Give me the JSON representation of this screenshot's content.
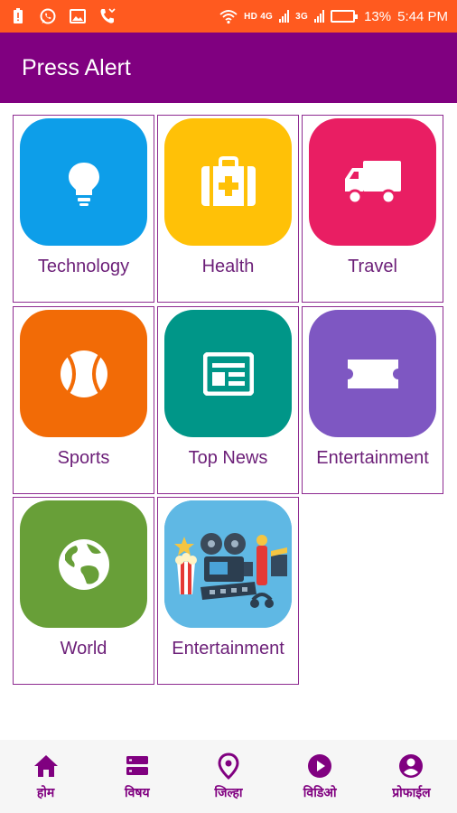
{
  "status_bar": {
    "network_hd": "HD 4G",
    "network_3g": "3G",
    "battery": "13%",
    "time": "5:44 PM"
  },
  "app_bar": {
    "title": "Press Alert"
  },
  "categories": [
    {
      "label": "Technology",
      "color": "#0d9ee9",
      "icon": "lightbulb-icon"
    },
    {
      "label": "Health",
      "color": "#ffc107",
      "icon": "first-aid-kit-icon"
    },
    {
      "label": "Travel",
      "color": "#e91e63",
      "icon": "truck-icon"
    },
    {
      "label": "Sports",
      "color": "#f26b06",
      "icon": "ball-icon"
    },
    {
      "label": "Top News",
      "color": "#009688",
      "icon": "newspaper-icon"
    },
    {
      "label": "Entertainment",
      "color": "#7e57c2",
      "icon": "ticket-icon"
    },
    {
      "label": "World",
      "color": "#689f38",
      "icon": "globe-icon"
    },
    {
      "label": "Entertainment",
      "color": "#5fb8e4",
      "icon": "cinema-collage-icon"
    }
  ],
  "bottom_nav": [
    {
      "label": "होम",
      "icon": "home-icon"
    },
    {
      "label": "विषय",
      "icon": "list-icon"
    },
    {
      "label": "जिल्हा",
      "icon": "location-pin-icon"
    },
    {
      "label": "विडिओ",
      "icon": "play-icon"
    },
    {
      "label": "प्रोफाईल",
      "icon": "profile-icon"
    }
  ],
  "colors": {
    "status_bar": "#ff5a1f",
    "app_bar": "#800080",
    "tile_border": "#8e2b91",
    "label": "#6c1f78",
    "nav_bg": "#f6f6f6"
  }
}
